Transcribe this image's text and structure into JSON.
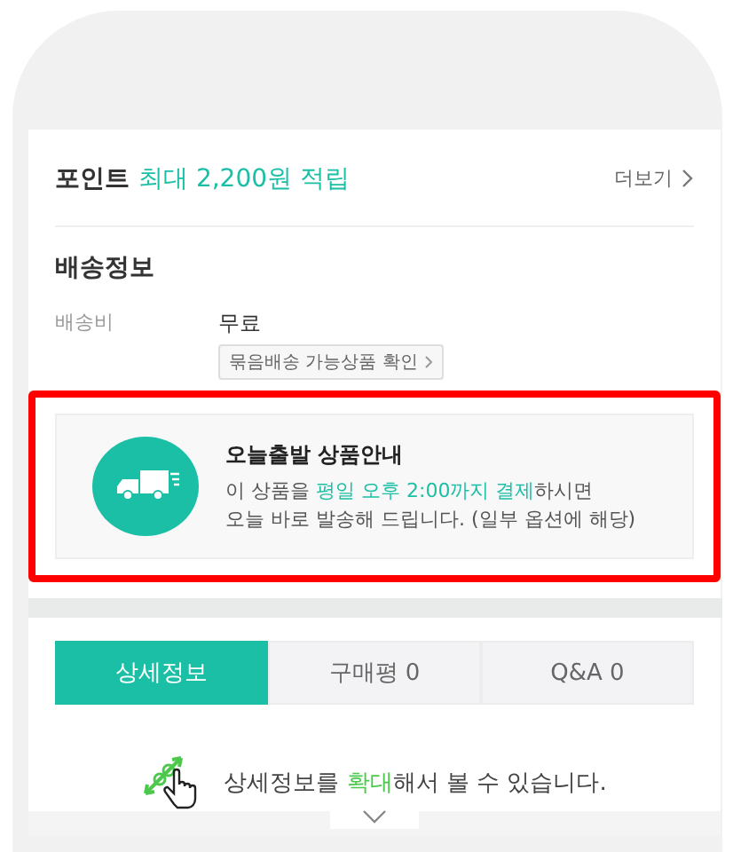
{
  "points": {
    "label": "포인트",
    "value": "최대 2,200원 적립",
    "more": "더보기"
  },
  "shipping": {
    "title": "배송정보",
    "fee_label": "배송비",
    "fee_value": "무료",
    "bundle_button": "묶음배송 가능상품 확인"
  },
  "notice": {
    "highlighted": true,
    "title": "오늘출발 상품안내",
    "line1": "이 상품을 **평일 오후 2:00까지 결제**하시면",
    "line2": "오늘 바로 발송해 드립니다. (일부 옵션에 해당)"
  },
  "tabs": [
    {
      "label": "상세정보",
      "selected": true
    },
    {
      "label": "구매평 0",
      "selected": false
    },
    {
      "label": "Q&A 0",
      "selected": false
    }
  ],
  "zoom_hint": "상세정보를 **확대**해서 볼 수 있습니다."
}
